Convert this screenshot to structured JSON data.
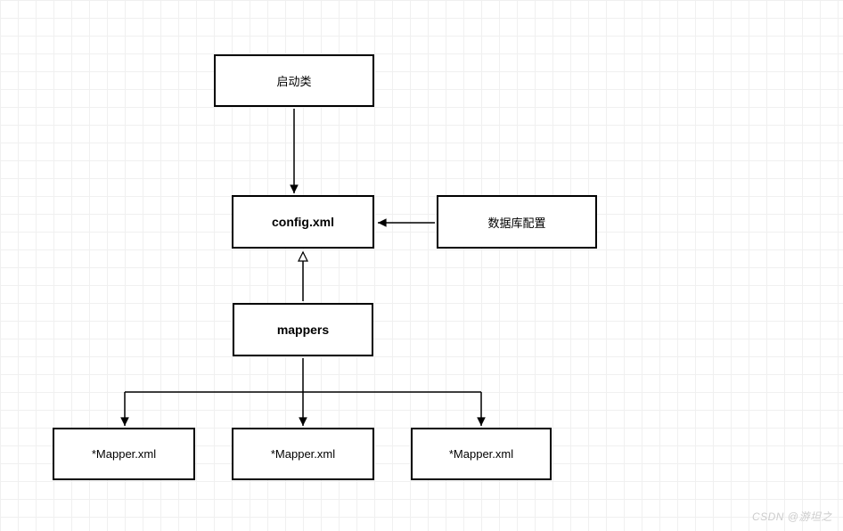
{
  "nodes": {
    "startup": "启动类",
    "config": "config.xml",
    "dbconfig": "数据库配置",
    "mappers": "mappers",
    "mapper1": "*Mapper.xml",
    "mapper2": "*Mapper.xml",
    "mapper3": "*Mapper.xml"
  },
  "watermark": "CSDN @游坦之"
}
